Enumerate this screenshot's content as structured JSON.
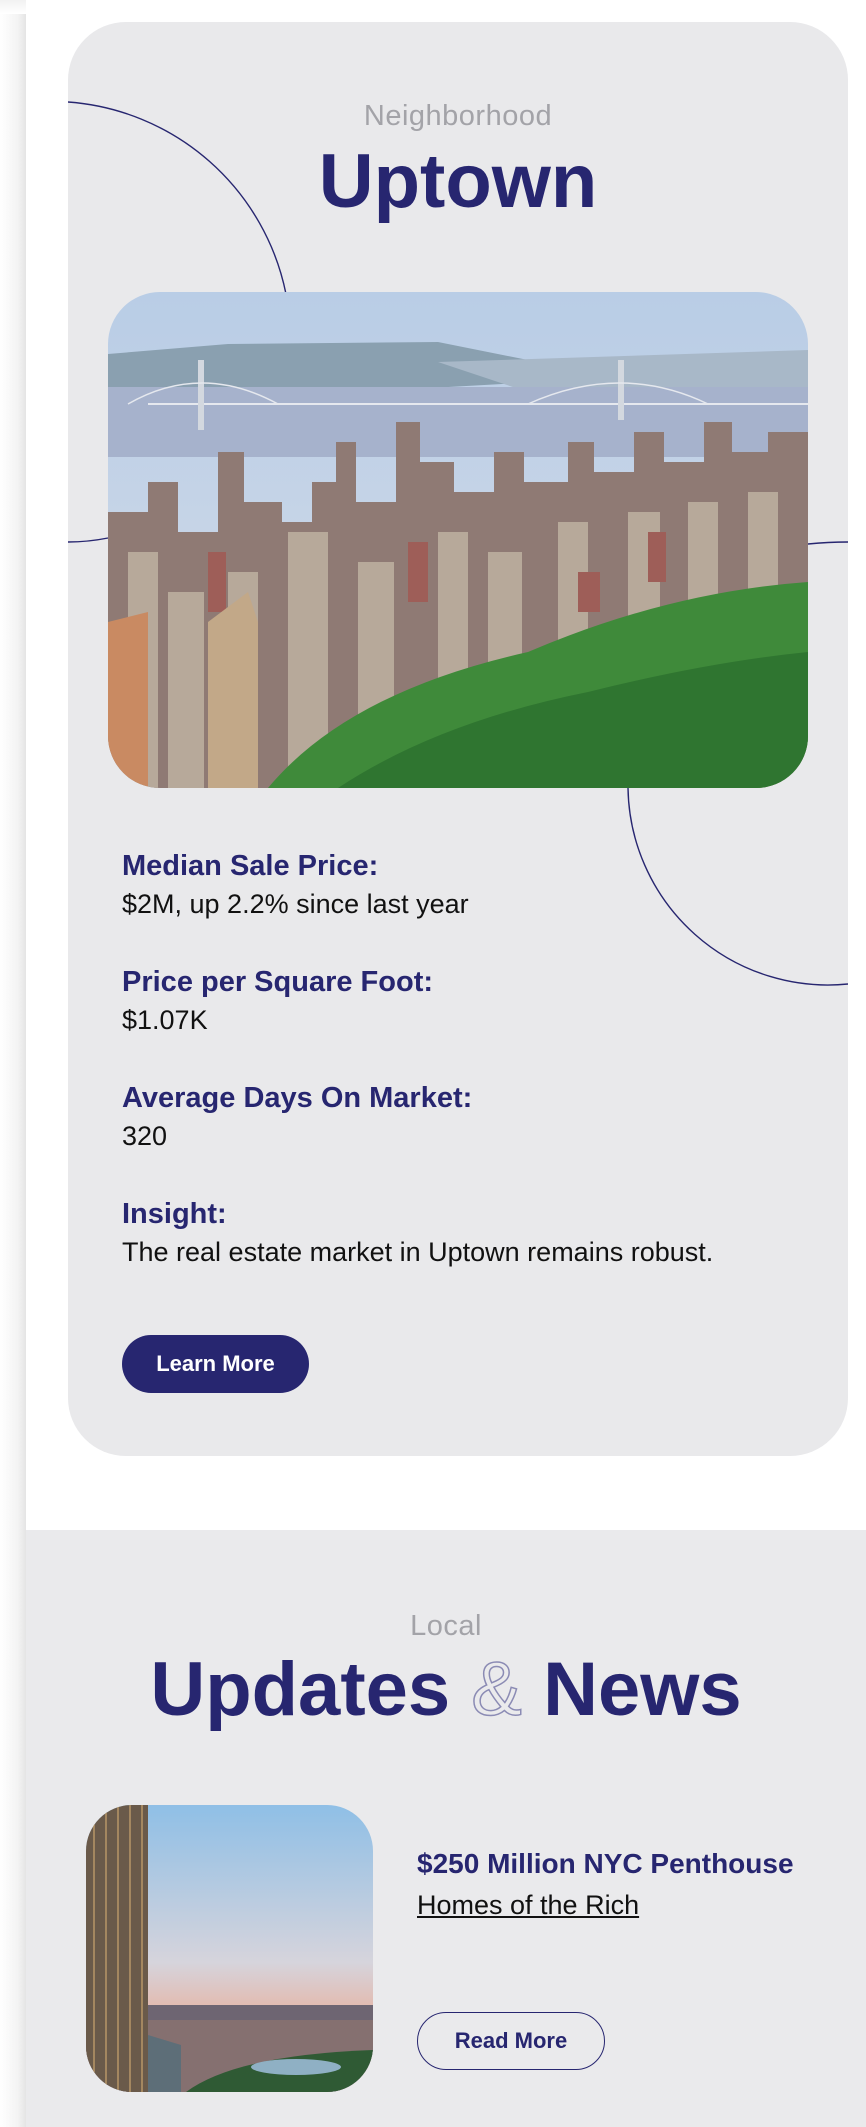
{
  "neighborhood": {
    "kicker": "Neighborhood",
    "title": "Uptown",
    "stats": [
      {
        "label": "Median Sale Price:",
        "value": "$2M, up 2.2% since last year"
      },
      {
        "label": "Price per Square Foot:",
        "value": "$1.07K"
      },
      {
        "label": "Average Days On Market:",
        "value": "320"
      },
      {
        "label": "Insight:",
        "value": "The real estate market in Uptown remains robust."
      }
    ],
    "button_label": "Learn More"
  },
  "news": {
    "kicker": "Local",
    "title_left": "Updates",
    "title_amp": "&",
    "title_right": "News",
    "article": {
      "title": "$250 Million NYC Penthouse",
      "link": "Homes of the Rich",
      "button_label": "Read More"
    }
  },
  "colors": {
    "accent": "#272670",
    "card_bg": "#e9e9eb",
    "muted_text": "#a3a3a8"
  },
  "icons": {
    "hero_image": "city-skyline-photo",
    "article_image": "penthouse-view-photo"
  }
}
